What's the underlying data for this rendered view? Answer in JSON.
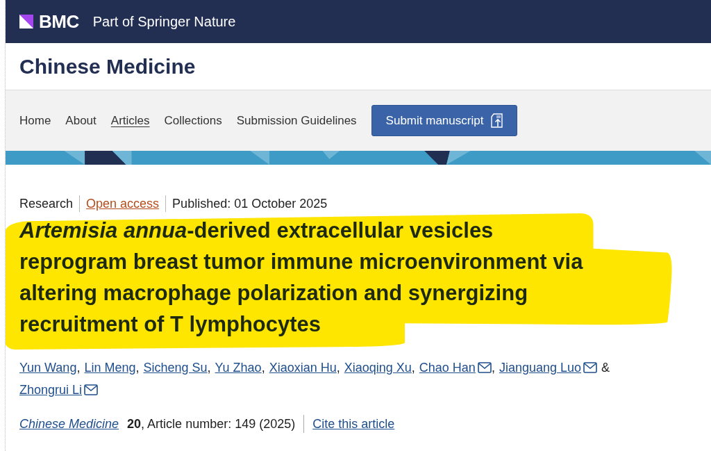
{
  "header": {
    "brand": "BMC",
    "tagline": "Part of Springer Nature"
  },
  "journal_title": "Chinese Medicine",
  "nav": {
    "items": [
      {
        "label": "Home",
        "selected": false
      },
      {
        "label": "About",
        "selected": false
      },
      {
        "label": "Articles",
        "selected": true
      },
      {
        "label": "Collections",
        "selected": false
      },
      {
        "label": "Submission Guidelines",
        "selected": false
      }
    ],
    "submit_button": "Submit manuscript"
  },
  "article": {
    "type": "Research",
    "access": "Open access",
    "published": "Published: 01 October 2025",
    "title": "*Artemisia annua*-derived extracellular vesicles reprogram breast tumor immune microenvironment via altering macrophage polarization and synergizing recruitment of T lymphocytes",
    "highlighted": true,
    "authors": [
      {
        "name": "Yun Wang",
        "email": false,
        "separator": ","
      },
      {
        "name": "Lin Meng",
        "email": false,
        "separator": ","
      },
      {
        "name": "Sicheng Su",
        "email": false,
        "separator": ","
      },
      {
        "name": "Yu Zhao",
        "email": false,
        "separator": ","
      },
      {
        "name": "Xiaoxian Hu",
        "email": false,
        "separator": ","
      },
      {
        "name": "Xiaoqing Xu",
        "email": false,
        "separator": ","
      },
      {
        "name": "Chao Han",
        "email": true,
        "separator": ","
      },
      {
        "name": "Jianguang Luo",
        "email": true,
        "separator": "&"
      },
      {
        "name": "Zhongrui Li",
        "email": true
      }
    ],
    "journal": "Chinese Medicine",
    "citation": "**20**, Article number: 149 (2025)",
    "cite_link": "Cite this article"
  }
}
